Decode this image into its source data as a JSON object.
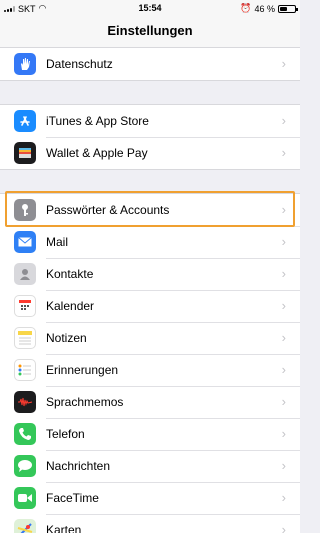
{
  "status_bar": {
    "carrier": "SKT",
    "time": "15:54",
    "battery": "46 %"
  },
  "nav": {
    "title": "Einstellungen"
  },
  "groups": [
    {
      "items": [
        {
          "label": "Datenschutz",
          "icon": "hand-icon",
          "color": "#3478f6"
        }
      ]
    },
    {
      "items": [
        {
          "label": "iTunes & App Store",
          "icon": "app-store-icon",
          "color": "#1a8cff"
        },
        {
          "label": "Wallet & Apple Pay",
          "icon": "wallet-icon",
          "color": "#1c1c1e"
        }
      ]
    },
    {
      "items": [
        {
          "label": "Passwörter & Accounts",
          "icon": "key-icon",
          "color": "#8e8e93"
        },
        {
          "label": "Mail",
          "icon": "mail-icon",
          "color": "#2f80f5"
        },
        {
          "label": "Kontakte",
          "icon": "contacts-icon",
          "color": "#b0b0b5"
        },
        {
          "label": "Kalender",
          "icon": "calendar-icon",
          "color": "#ffffff"
        },
        {
          "label": "Notizen",
          "icon": "notes-icon",
          "color": "#f8d648"
        },
        {
          "label": "Erinnerungen",
          "icon": "reminders-icon",
          "color": "#ffffff"
        },
        {
          "label": "Sprachmemos",
          "icon": "voice-memos-icon",
          "color": "#1c1c1e"
        },
        {
          "label": "Telefon",
          "icon": "phone-icon",
          "color": "#34c759"
        },
        {
          "label": "Nachrichten",
          "icon": "messages-icon",
          "color": "#34c759"
        },
        {
          "label": "FaceTime",
          "icon": "facetime-icon",
          "color": "#34c759"
        },
        {
          "label": "Karten",
          "icon": "maps-icon",
          "color": "#7fc97a"
        }
      ]
    }
  ],
  "highlight_color": "#f0a030"
}
